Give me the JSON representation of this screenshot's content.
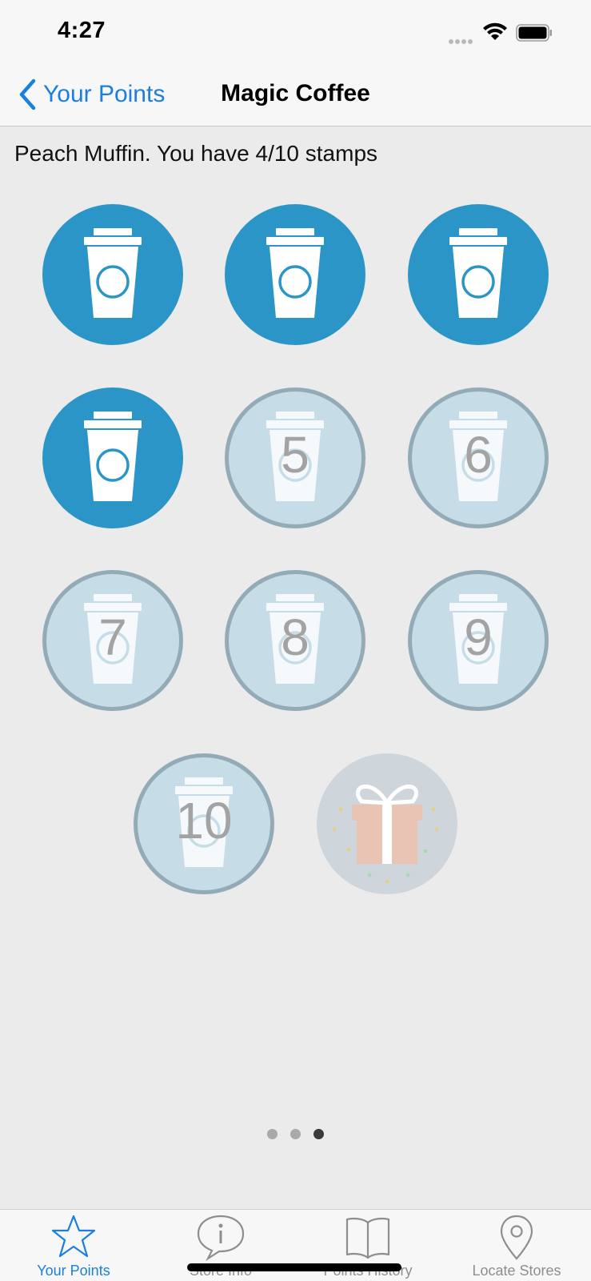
{
  "status_bar": {
    "time": "4:27"
  },
  "nav": {
    "back_label": "Your Points",
    "title": "Magic Coffee"
  },
  "card": {
    "subtitle": "Peach Muffin. You have 4/10 stamps",
    "stamps_collected": 4,
    "stamps_total": 10,
    "stamp_numbers": [
      "5",
      "6",
      "7",
      "8",
      "9",
      "10"
    ]
  },
  "pager": {
    "pages": 3,
    "current_page": 3
  },
  "tabs": [
    {
      "label": "Your Points",
      "icon": "star-icon",
      "active": true
    },
    {
      "label": "Store Info",
      "icon": "info-bubble-icon",
      "active": false
    },
    {
      "label": "Points History",
      "icon": "book-icon",
      "active": false
    },
    {
      "label": "Locate Stores",
      "icon": "map-pin-icon",
      "active": false
    }
  ],
  "colors": {
    "accent": "#1a7fe0",
    "stamp_filled": "#2a95c6",
    "stamp_empty": "#c6dce7",
    "stamp_empty_border": "#93aab7"
  }
}
